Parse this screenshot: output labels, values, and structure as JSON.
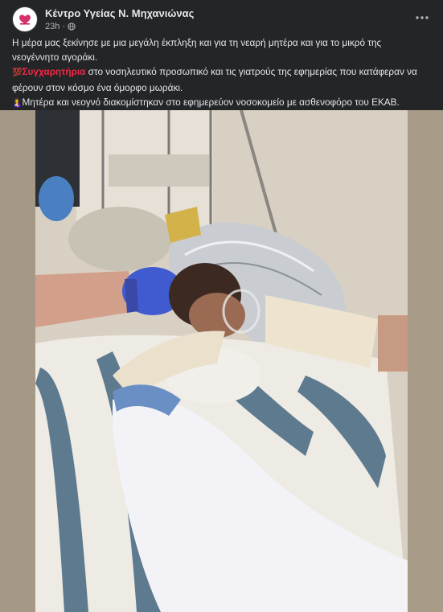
{
  "post": {
    "page_name": "Κέντρο Υγείας Ν. Μηχανιώνας",
    "time": "23h",
    "separator": "·",
    "privacy_icon": "globe-icon",
    "more_icon": "more-horizontal-icon",
    "paragraph1": "Η μέρα μας ξεκίνησε με μια μεγάλη έκπληξη και για τη νεαρή μητέρα και για το μικρό της νεογέννητο αγοράκι.",
    "paragraph2_emoji": "💯",
    "paragraph2_highlight": "Συγχαρητήρια",
    "paragraph2_rest": " στο νοσηλευτικό προσωπικό και τις γιατρούς της εφημερίας που κατάφεραν να φέρουν στον κόσμο ένα όμορφο μωράκι.",
    "paragraph3_emoji": "🤱",
    "paragraph3_rest": "Μητέρα και νεογνό διακομίστηκαν στο εφημερεύον νοσοκομείο με ασθενοφόρο του ΕΚΑΒ."
  },
  "colors": {
    "background": "#242526",
    "text": "#e4e6eb",
    "secondary_text": "#b0b3b8",
    "highlight": "#f02849"
  }
}
